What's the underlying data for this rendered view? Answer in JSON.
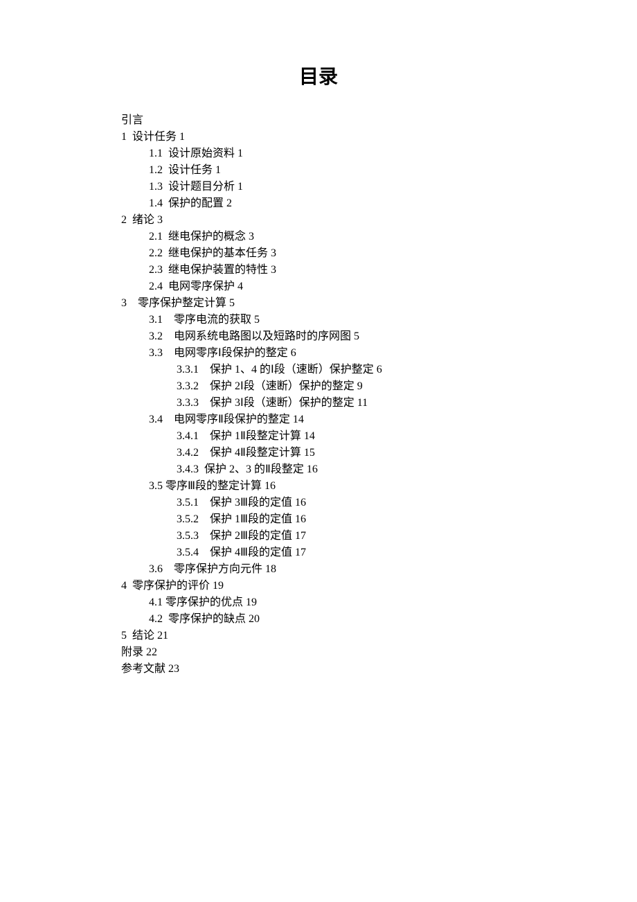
{
  "title": "目录",
  "toc": [
    {
      "level": 0,
      "text": "引言"
    },
    {
      "level": 0,
      "text": "1  设计任务 1"
    },
    {
      "level": 1,
      "text": "1.1  设计原始资料 1"
    },
    {
      "level": 1,
      "text": "1.2  设计任务 1"
    },
    {
      "level": 1,
      "text": "1.3  设计题目分析 1"
    },
    {
      "level": 1,
      "text": "1.4  保护的配置 2"
    },
    {
      "level": 0,
      "text": "2  绪论 3"
    },
    {
      "level": 1,
      "text": "2.1  继电保护的概念 3"
    },
    {
      "level": 1,
      "text": "2.2  继电保护的基本任务 3"
    },
    {
      "level": 1,
      "text": "2.3  继电保护装置的特性 3"
    },
    {
      "level": 1,
      "text": "2.4  电网零序保护 4"
    },
    {
      "level": 0,
      "text": "3    零序保护整定计算 5"
    },
    {
      "level": 1,
      "text": "3.1    零序电流的获取 5"
    },
    {
      "level": 1,
      "text": "3.2    电网系统电路图以及短路时的序网图 5"
    },
    {
      "level": 1,
      "text": "3.3    电网零序Ⅰ段保护的整定 6"
    },
    {
      "level": 2,
      "text": "3.3.1    保护 1、4 的Ⅰ段（速断）保护整定 6"
    },
    {
      "level": 2,
      "text": "3.3.2    保护 2Ⅰ段（速断）保护的整定 9"
    },
    {
      "level": 2,
      "text": "3.3.3    保护 3Ⅰ段（速断）保护的整定 11"
    },
    {
      "level": 1,
      "text": "3.4    电网零序Ⅱ段保护的整定 14"
    },
    {
      "level": 2,
      "text": "3.4.1    保护 1Ⅱ段整定计算 14"
    },
    {
      "level": 2,
      "text": "3.4.2    保护 4Ⅱ段整定计算 15"
    },
    {
      "level": 2,
      "text": "3.4.3  保护 2、3 的Ⅱ段整定 16"
    },
    {
      "level": 1,
      "text": "3.5 零序Ⅲ段的整定计算 16"
    },
    {
      "level": 2,
      "text": "3.5.1    保护 3Ⅲ段的定值 16"
    },
    {
      "level": 2,
      "text": "3.5.2    保护 1Ⅲ段的定值 16"
    },
    {
      "level": 2,
      "text": "3.5.3    保护 2Ⅲ段的定值 17"
    },
    {
      "level": 2,
      "text": "3.5.4    保护 4Ⅲ段的定值 17"
    },
    {
      "level": 1,
      "text": "3.6    零序保护方向元件 18"
    },
    {
      "level": 0,
      "text": "4  零序保护的评价 19"
    },
    {
      "level": 1,
      "text": "4.1 零序保护的优点 19"
    },
    {
      "level": 1,
      "text": "4.2  零序保护的缺点 20"
    },
    {
      "level": 0,
      "text": "5  结论 21"
    },
    {
      "level": 0,
      "text": "附录 22"
    },
    {
      "level": 0,
      "text": "参考文献 23"
    }
  ]
}
